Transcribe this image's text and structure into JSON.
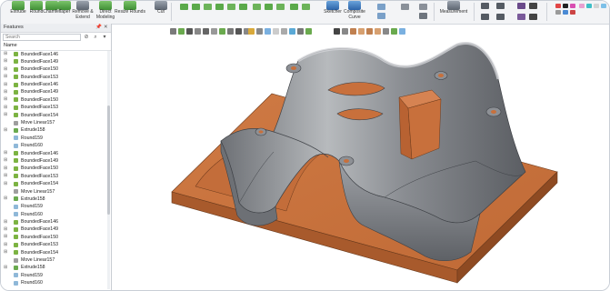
{
  "ribbon": {
    "buttons": [
      {
        "label": "Extrude",
        "icon": "extrude-icon"
      },
      {
        "label": "Round",
        "icon": "round-icon"
      },
      {
        "label": "Chamfer",
        "icon": "chamfer-icon"
      },
      {
        "label": "Taper",
        "icon": "taper-icon"
      },
      {
        "label": "Remove &\nExtend",
        "icon": "remove-extend-icon"
      },
      {
        "label": "Direct\nModeling",
        "icon": "direct-modeling-icon"
      },
      {
        "label": "Resize Rounds",
        "icon": "resize-rounds-icon"
      },
      {
        "label": "Cut",
        "icon": "cut-icon"
      },
      {
        "label": "Sketcher",
        "icon": "sketcher-icon"
      },
      {
        "label": "Composite\nCurve",
        "icon": "composite-curve-icon"
      },
      {
        "label": "Measurement",
        "icon": "measurement-icon"
      }
    ]
  },
  "panel": {
    "title": "Features",
    "pin": "📌",
    "close": "✕",
    "search_placeholder": "Search",
    "column_header": "Name",
    "items": [
      {
        "label": "BoundedFace146",
        "kind": "face"
      },
      {
        "label": "BoundedFace149",
        "kind": "face"
      },
      {
        "label": "BoundedFace150",
        "kind": "face"
      },
      {
        "label": "BoundedFace153",
        "kind": "face"
      },
      {
        "label": "BoundedFace146",
        "kind": "face"
      },
      {
        "label": "BoundedFace149",
        "kind": "face"
      },
      {
        "label": "BoundedFace150",
        "kind": "face"
      },
      {
        "label": "BoundedFace153",
        "kind": "face"
      },
      {
        "label": "BoundedFace154",
        "kind": "face"
      },
      {
        "label": "Move Linear157",
        "kind": "move"
      },
      {
        "label": "Extrude158",
        "kind": "extrude"
      },
      {
        "label": "Round159",
        "kind": "round"
      },
      {
        "label": "Round160",
        "kind": "round"
      },
      {
        "label": "BoundedFace146",
        "kind": "face"
      },
      {
        "label": "BoundedFace149",
        "kind": "face"
      },
      {
        "label": "BoundedFace150",
        "kind": "face"
      },
      {
        "label": "BoundedFace153",
        "kind": "face"
      },
      {
        "label": "BoundedFace154",
        "kind": "face"
      },
      {
        "label": "Move Linear157",
        "kind": "move"
      },
      {
        "label": "Extrude158",
        "kind": "extrude"
      },
      {
        "label": "Round159",
        "kind": "round"
      },
      {
        "label": "Round160",
        "kind": "round"
      },
      {
        "label": "BoundedFace146",
        "kind": "face"
      },
      {
        "label": "BoundedFace149",
        "kind": "face"
      },
      {
        "label": "BoundedFace150",
        "kind": "face"
      },
      {
        "label": "BoundedFace153",
        "kind": "face"
      },
      {
        "label": "BoundedFace154",
        "kind": "face"
      },
      {
        "label": "Move Linear157",
        "kind": "move"
      },
      {
        "label": "Extrude158",
        "kind": "extrude"
      },
      {
        "label": "Round159",
        "kind": "round"
      },
      {
        "label": "Round160",
        "kind": "round"
      }
    ]
  },
  "colors": {
    "base_orange": "#c8703c",
    "part_gray": "#8a8d92",
    "tree_face": "#7cb342",
    "tree_move": "#9e9e9e",
    "tree_extrude": "#6aaa4e",
    "tree_round": "#8fb8d8"
  }
}
